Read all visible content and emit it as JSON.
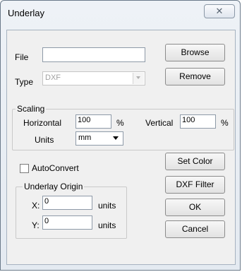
{
  "window": {
    "title": "Underlay",
    "close_glyph": "✕"
  },
  "file": {
    "label": "File",
    "value": ""
  },
  "type": {
    "label": "Type",
    "selected": "DXF",
    "disabled": true
  },
  "buttons": {
    "browse": "Browse",
    "remove": "Remove",
    "set_color": "Set Color",
    "dxf_filter": "DXF Filter",
    "ok": "OK",
    "cancel": "Cancel"
  },
  "scaling": {
    "title": "Scaling",
    "horizontal_label": "Horizontal",
    "horizontal_value": "100",
    "vertical_label": "Vertical",
    "vertical_value": "100",
    "percent": "%",
    "units_label": "Units",
    "units_value": "mm"
  },
  "autoconvert": {
    "label": "AutoConvert",
    "checked": false
  },
  "origin": {
    "title": "Underlay Origin",
    "x_label": "X:",
    "x_value": "0",
    "y_label": "Y:",
    "y_value": "0",
    "units": "units"
  },
  "icons": [
    "close-icon",
    "dropdown-arrow-icon",
    "checkbox-icon"
  ]
}
